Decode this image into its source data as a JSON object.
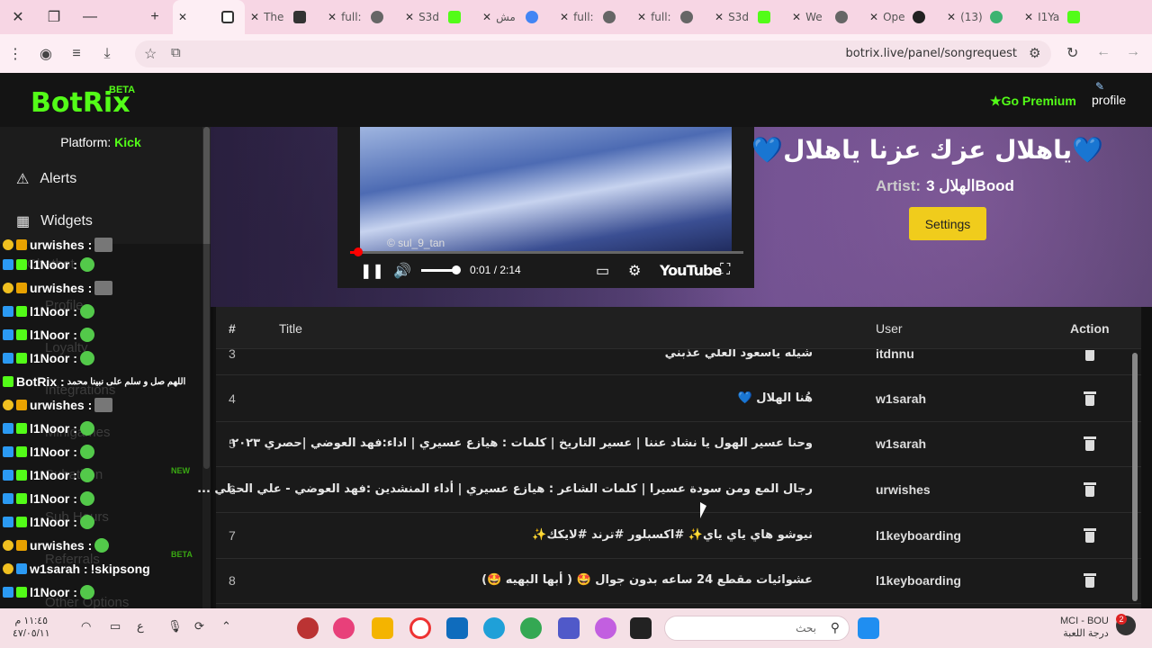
{
  "browser": {
    "tabs": [
      {
        "label": "",
        "active": true
      },
      {
        "label": "The"
      },
      {
        "label": "full:"
      },
      {
        "label": "S3d"
      },
      {
        "label": "مش"
      },
      {
        "label": "full:"
      },
      {
        "label": "full:"
      },
      {
        "label": "S3d"
      },
      {
        "label": "We"
      },
      {
        "label": "Ope"
      },
      {
        "label": "(13)"
      },
      {
        "label": "I1Ya"
      }
    ],
    "url": "botrix.live/panel/songrequest"
  },
  "header": {
    "logo": "BotRix",
    "beta": "BETA",
    "premium": "Go Premium",
    "profile": "profile"
  },
  "sidebar": {
    "platform_label": "Platform:",
    "platform_value": "Kick",
    "items": [
      {
        "label": "Alerts",
        "icon": "warning-icon"
      },
      {
        "label": "Widgets",
        "icon": "grid-icon"
      },
      {
        "label": "Chatbot"
      },
      {
        "label": "Profile"
      },
      {
        "label": "Loyalty"
      },
      {
        "label": "Integrations"
      },
      {
        "label": "Minigames"
      },
      {
        "label": "Subathon",
        "badge": "NEW"
      },
      {
        "label": "Sub Hours"
      },
      {
        "label": "Referrals",
        "badge": "BETA"
      },
      {
        "label": "Other Options"
      }
    ]
  },
  "chat": [
    {
      "user": "urwishes :",
      "text": ""
    },
    {
      "user": "l1Noor :",
      "text": ""
    },
    {
      "user": "urwishes :",
      "text": ""
    },
    {
      "user": "l1Noor :",
      "text": ""
    },
    {
      "user": "l1Noor :",
      "text": ""
    },
    {
      "user": "l1Noor :",
      "text": ""
    },
    {
      "user": "BotRix :",
      "text": "اللهم صل و سلم على نبينا محمد"
    },
    {
      "user": "urwishes :",
      "text": ""
    },
    {
      "user": "l1Noor :",
      "text": ""
    },
    {
      "user": "l1Noor :",
      "text": ""
    },
    {
      "user": "l1Noor :",
      "text": ""
    },
    {
      "user": "l1Noor :",
      "text": ""
    },
    {
      "user": "l1Noor :",
      "text": ""
    },
    {
      "user": "urwishes :",
      "text": ""
    },
    {
      "user": "w1sarah :",
      "text": "!skipsong"
    },
    {
      "user": "l1Noor :",
      "text": ""
    }
  ],
  "player": {
    "watermark": "© sul_9_tan",
    "time": "0:01 / 2:14",
    "progress": 0.02,
    "volume": 0.9,
    "brand": "YouTube"
  },
  "now_playing": {
    "title": "💙ياهلال عزك عزنا ياهلال💙",
    "artist_label": "Artist:",
    "artist_value": "الهلال 3Bood",
    "settings_label": "Settings"
  },
  "queue": {
    "headers": {
      "num": "#",
      "title": "Title",
      "user": "User",
      "action": "Action"
    },
    "rows": [
      {
        "num": "3",
        "title": "شيله ياسعود العلي عذبني",
        "user": "itdnnu"
      },
      {
        "num": "4",
        "title": "هُنا الهلال 💙",
        "user": "w1sarah"
      },
      {
        "num": "5",
        "title": "وحنا عسير الهول يا نشاد عننا | عسير التاريخ | كلمات : هيازع عسيري | اداء:فهد العوضي |حصري ٢٠٢٣",
        "user": "w1sarah"
      },
      {
        "num": "6",
        "title": "رجال المع ومن سودة عسيرا | كلمات الشاعر : هيازع عسيري | أداء المنشدين :فهد العوضي - علي الحيلي ...",
        "user": "urwishes"
      },
      {
        "num": "7",
        "title": "نيوشو هاي ياي ياي✨ #اكسبلور #ترند #لايكك✨",
        "user": "l1keyboarding"
      },
      {
        "num": "8",
        "title": "عشوائيات مقطع 24 ساعه بدون جوال 🤩 ( أبها البهيه 🤩)",
        "user": "l1keyboarding"
      }
    ]
  },
  "taskbar": {
    "search_placeholder": "بحث",
    "clock_time": "١١:٤٥ م",
    "clock_date": "٤٧/٠٥/١١",
    "weather_title": "MCI - BOU",
    "weather_sub": "درجة اللعبة",
    "notif_count": "2",
    "lang": "ع"
  }
}
